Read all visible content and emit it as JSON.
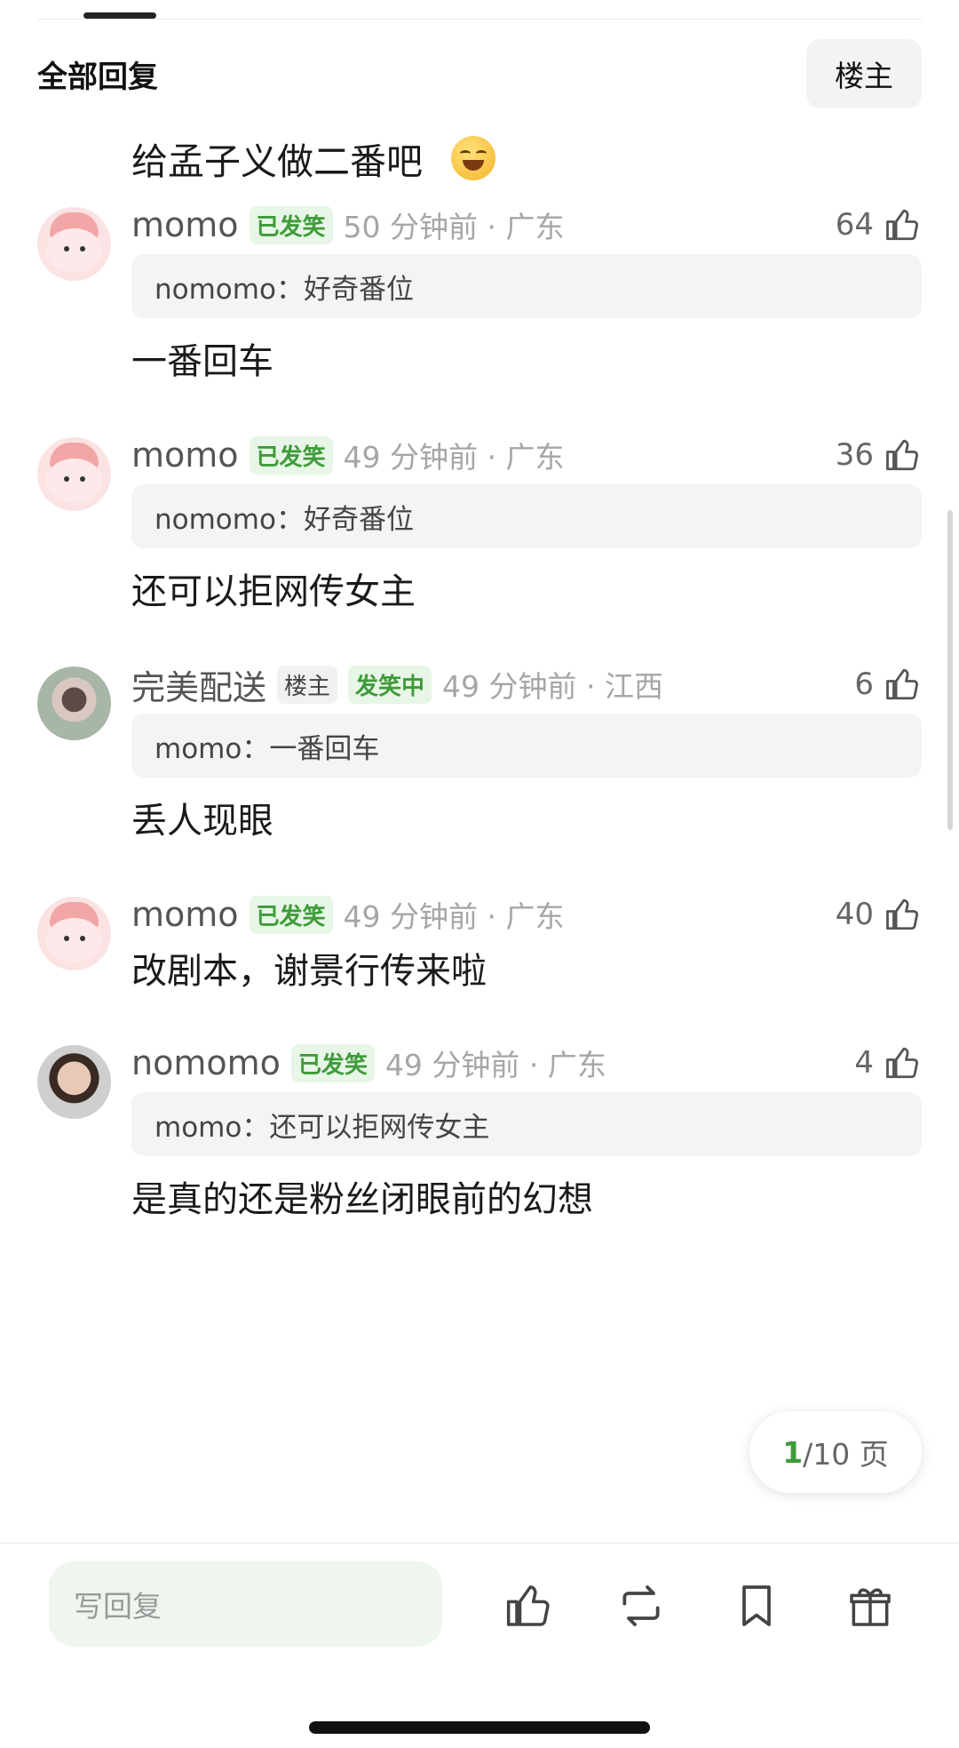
{
  "header": {
    "title": "全部回复",
    "op_filter_label": "楼主"
  },
  "top_snippet": {
    "text": "给孟子义做二番吧",
    "emoji": "rolling-on-floor-laughing-emoji"
  },
  "comments": [
    {
      "username": "momo",
      "badges": [
        "已发笑"
      ],
      "time": "50 分钟前 · 广东",
      "likes": "64",
      "quote": "nomomo：好奇番位",
      "text": "一番回车"
    },
    {
      "username": "momo",
      "badges": [
        "已发笑"
      ],
      "time": "49 分钟前 · 广东",
      "likes": "36",
      "quote": "nomomo：好奇番位",
      "text": "还可以拒网传女主"
    },
    {
      "username": "完美配送",
      "badges": [
        "楼主",
        "发笑中"
      ],
      "time": "49 分钟前 · 江西",
      "likes": "6",
      "quote": "momo：一番回车",
      "text": "丢人现眼"
    },
    {
      "username": "momo",
      "badges": [
        "已发笑"
      ],
      "time": "49 分钟前 · 广东",
      "likes": "40",
      "quote": "",
      "text": "改剧本，谢景行传来啦"
    },
    {
      "username": "nomomo",
      "badges": [
        "已发笑"
      ],
      "time": "49 分钟前 · 广东",
      "likes": "4",
      "quote": "momo：还可以拒网传女主",
      "text": "是真的还是粉丝闭眼前的幻想"
    }
  ],
  "pagination": {
    "current": "1",
    "rest": "/10 页"
  },
  "bottom_bar": {
    "reply_placeholder": "写回复",
    "icons": [
      "thumb-up-icon",
      "repost-icon",
      "bookmark-icon",
      "gift-icon"
    ]
  },
  "colors": {
    "accent_green": "#3f9b3a",
    "badge_green_bg": "#e7f6e6",
    "quote_bg": "#f4f4f4",
    "reply_bg": "#eef6ee"
  }
}
